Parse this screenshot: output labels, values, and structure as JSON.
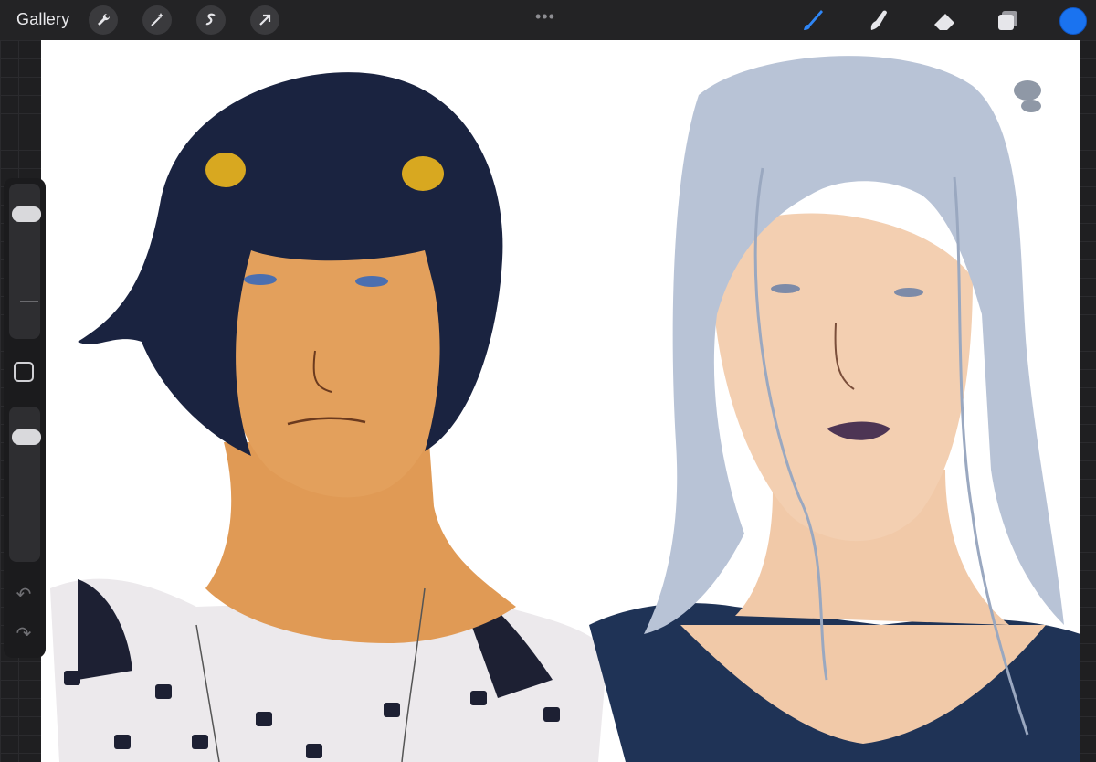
{
  "app": {
    "gallery_label": "Gallery",
    "menu_dots": "•••"
  },
  "toolbar": {
    "left_tools": [
      "wrench-icon",
      "magic-wand-icon",
      "selection-icon",
      "move-arrow-icon"
    ],
    "right_tools": [
      "brush-icon",
      "smudge-icon",
      "eraser-icon",
      "layers-icon"
    ],
    "active_tool": "brush-icon",
    "current_color": "#1a73f0"
  },
  "sidebar": {
    "brush_size_level": 0.85,
    "opacity_level": 0.85,
    "undo_glyph": "↶",
    "redo_glyph": "↷"
  },
  "artwork": {
    "left_hair": "#1a2340",
    "left_skin": "#e09a55",
    "right_hair": "#b8c3d6",
    "right_skin": "#f1c9a8",
    "hairclip": "#d8a820",
    "shirt_dark": "#1f3356",
    "shirt_light": "#ece9ec"
  }
}
